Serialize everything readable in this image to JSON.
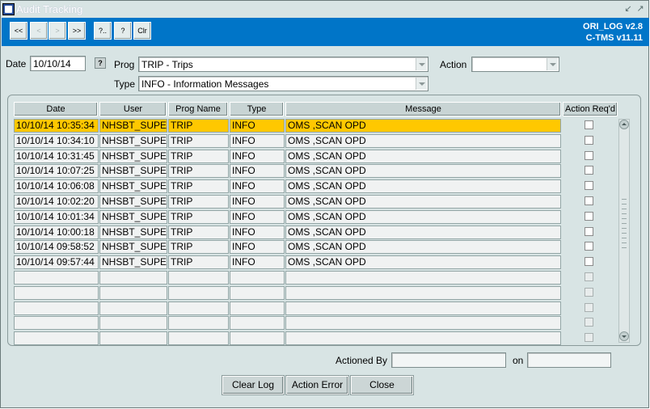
{
  "window": {
    "title": "Audit Tracking"
  },
  "toolbar": {
    "first_label": "<<",
    "prev_label": "<",
    "next_label": ">",
    "last_label": ">>",
    "query_label": "?..",
    "help_label": "?",
    "clear_label": "Clr"
  },
  "version": {
    "line1": "ORI_LOG v2.8",
    "line2": "C-TMS v11.11"
  },
  "filters": {
    "date_label": "Date",
    "date_value": "10/10/14",
    "date_lov_label": "?",
    "prog_label": "Prog",
    "prog_value": "TRIP - Trips",
    "action_label": "Action",
    "action_value": "",
    "type_label": "Type",
    "type_value": "INFO - Information Messages"
  },
  "table": {
    "columns": [
      "Date",
      "User",
      "Prog Name",
      "Type",
      "Message",
      "Action Req'd"
    ],
    "rows": [
      {
        "date": "10/10/14 10:35:34",
        "user": "NHSBT_SUPE",
        "prog": "TRIP",
        "type": "INFO",
        "message": "OMS  ,SCAN OPD"
      },
      {
        "date": "10/10/14 10:34:10",
        "user": "NHSBT_SUPE",
        "prog": "TRIP",
        "type": "INFO",
        "message": "OMS  ,SCAN OPD"
      },
      {
        "date": "10/10/14 10:31:45",
        "user": "NHSBT_SUPE",
        "prog": "TRIP",
        "type": "INFO",
        "message": "OMS  ,SCAN OPD"
      },
      {
        "date": "10/10/14 10:07:25",
        "user": "NHSBT_SUPE",
        "prog": "TRIP",
        "type": "INFO",
        "message": "OMS  ,SCAN OPD"
      },
      {
        "date": "10/10/14 10:06:08",
        "user": "NHSBT_SUPE",
        "prog": "TRIP",
        "type": "INFO",
        "message": "OMS  ,SCAN OPD"
      },
      {
        "date": "10/10/14 10:02:20",
        "user": "NHSBT_SUPE",
        "prog": "TRIP",
        "type": "INFO",
        "message": "OMS  ,SCAN OPD"
      },
      {
        "date": "10/10/14 10:01:34",
        "user": "NHSBT_SUPE",
        "prog": "TRIP",
        "type": "INFO",
        "message": "OMS  ,SCAN OPD"
      },
      {
        "date": "10/10/14 10:00:18",
        "user": "NHSBT_SUPE",
        "prog": "TRIP",
        "type": "INFO",
        "message": "OMS  ,SCAN OPD"
      },
      {
        "date": "10/10/14 09:58:52",
        "user": "NHSBT_SUPE",
        "prog": "TRIP",
        "type": "INFO",
        "message": "OMS  ,SCAN OPD"
      },
      {
        "date": "10/10/14 09:57:44",
        "user": "NHSBT_SUPE",
        "prog": "TRIP",
        "type": "INFO",
        "message": "OMS  ,SCAN OPD"
      }
    ],
    "selected_row": 0,
    "visible_row_count": 15
  },
  "footer": {
    "actioned_by_label": "Actioned By",
    "actioned_by_value": "",
    "on_label": "on",
    "on_value": "",
    "clear_log_label": "Clear Log",
    "action_error_label": "Action Error",
    "close_label": "Close"
  },
  "colors": {
    "toolbar": "#0075c8",
    "selected_row": "#ffc800",
    "window_bg": "#d8e4e4"
  }
}
